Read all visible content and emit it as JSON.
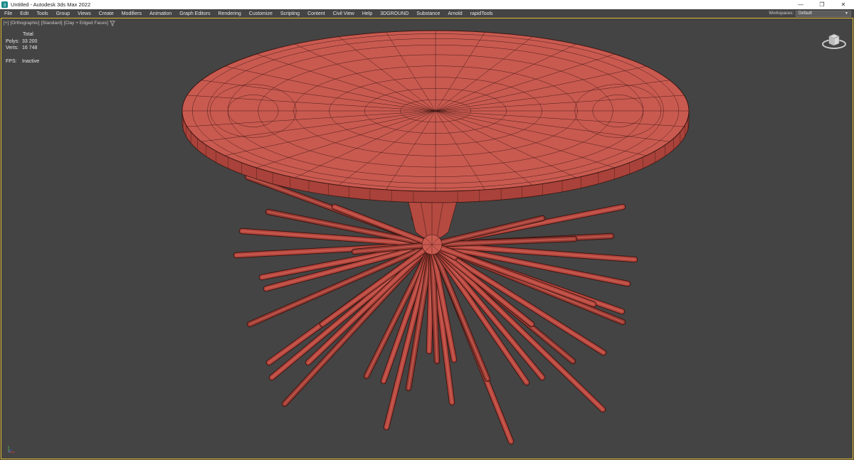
{
  "titlebar": {
    "title": "Untitled - Autodesk 3ds Max 2022",
    "minimize_glyph": "—",
    "maximize_glyph": "❐",
    "close_glyph": "✕"
  },
  "menubar": {
    "items": [
      "File",
      "Edit",
      "Tools",
      "Group",
      "Views",
      "Create",
      "Modifiers",
      "Animation",
      "Graph Editors",
      "Rendering",
      "Customize",
      "Scripting",
      "Content",
      "Civil View",
      "Help",
      "3DGROUND",
      "Substance",
      "Arnold",
      "rapidTools"
    ],
    "workspaces_label": "Workspaces:",
    "workspaces_value": "Default"
  },
  "viewport": {
    "label_parts": [
      "[+]",
      "[Orthographic]",
      "[Standard]",
      "[Clay + Edged Faces]"
    ],
    "filter_icon": "funnel-icon",
    "stats": {
      "total_label": "Total",
      "polys_label": "Polys:",
      "polys_value": "33 200",
      "verts_label": "Verts:",
      "verts_value": "16 748",
      "fps_label": "FPS:",
      "fps_value": "Inactive"
    },
    "colors": {
      "background": "#444444",
      "clay": "#c95a50",
      "clay_dark": "#9a3b33",
      "edge": "#3a1612",
      "active_border": "#e0b830"
    }
  }
}
